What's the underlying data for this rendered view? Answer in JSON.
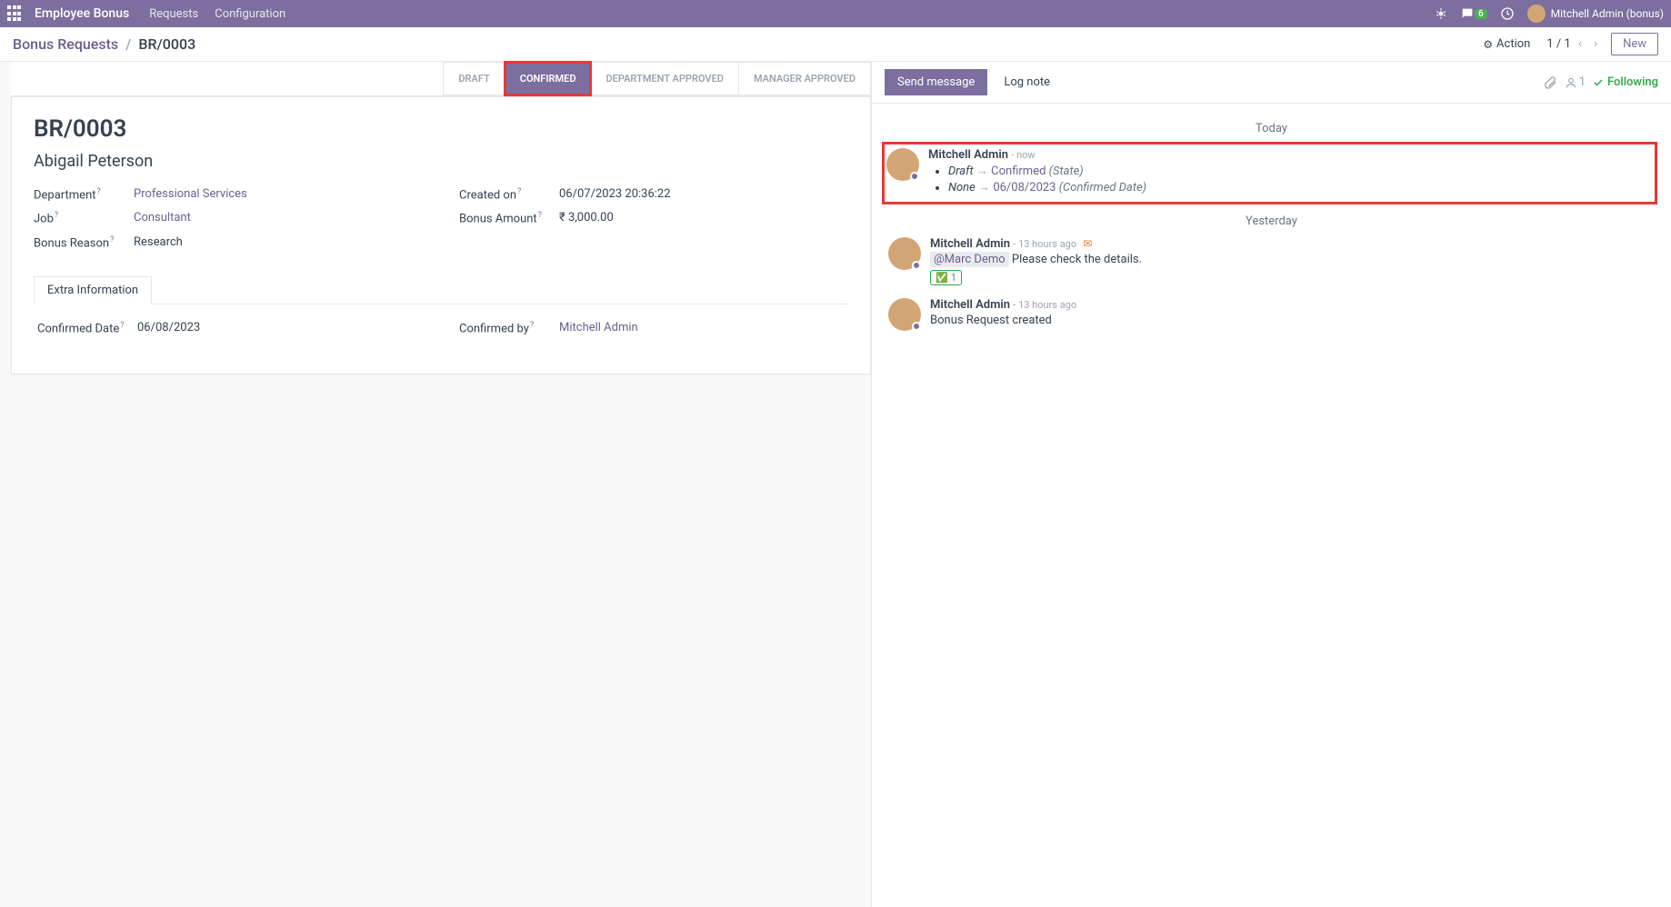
{
  "topbar": {
    "brand": "Employee Bonus",
    "nav": {
      "requests": "Requests",
      "configuration": "Configuration"
    },
    "chat_badge": "6",
    "username": "Mitchell Admin (bonus)"
  },
  "breadcrumb": {
    "root": "Bonus Requests",
    "current": "BR/0003"
  },
  "subhead": {
    "action": "Action",
    "pager": "1 / 1",
    "new_btn": "New"
  },
  "status": {
    "draft": "DRAFT",
    "confirmed": "CONFIRMED",
    "dept": "DEPARTMENT APPROVED",
    "mgr": "MANAGER APPROVED"
  },
  "form": {
    "title": "BR/0003",
    "employee": "Abigail Peterson",
    "labels": {
      "department": "Department",
      "job": "Job",
      "reason": "Bonus Reason",
      "created": "Created on",
      "amount": "Bonus Amount",
      "confirmed_date": "Confirmed Date",
      "confirmed_by": "Confirmed by"
    },
    "values": {
      "department": "Professional Services",
      "job": "Consultant",
      "reason": "Research",
      "created": "06/07/2023 20:36:22",
      "amount": "₹ 3,000.00",
      "confirmed_date": "06/08/2023",
      "confirmed_by": "Mitchell Admin"
    },
    "tab_extra": "Extra Information"
  },
  "chatter": {
    "send": "Send message",
    "log": "Log note",
    "followers_count": "1",
    "following": "Following",
    "today": "Today",
    "yesterday": "Yesterday",
    "msg1": {
      "author": "Mitchell Admin",
      "time": "now",
      "from": "Draft",
      "to": "Confirmed",
      "state_label": "(State)",
      "from2": "None",
      "to2": "06/08/2023",
      "cd_label": "(Confirmed Date)"
    },
    "msg2": {
      "author": "Mitchell Admin",
      "time": "13 hours ago",
      "mention": "@Marc Demo",
      "body": "Please check the details.",
      "reaction_count": "1"
    },
    "msg3": {
      "author": "Mitchell Admin",
      "time": "13 hours ago",
      "body": "Bonus Request created"
    }
  }
}
